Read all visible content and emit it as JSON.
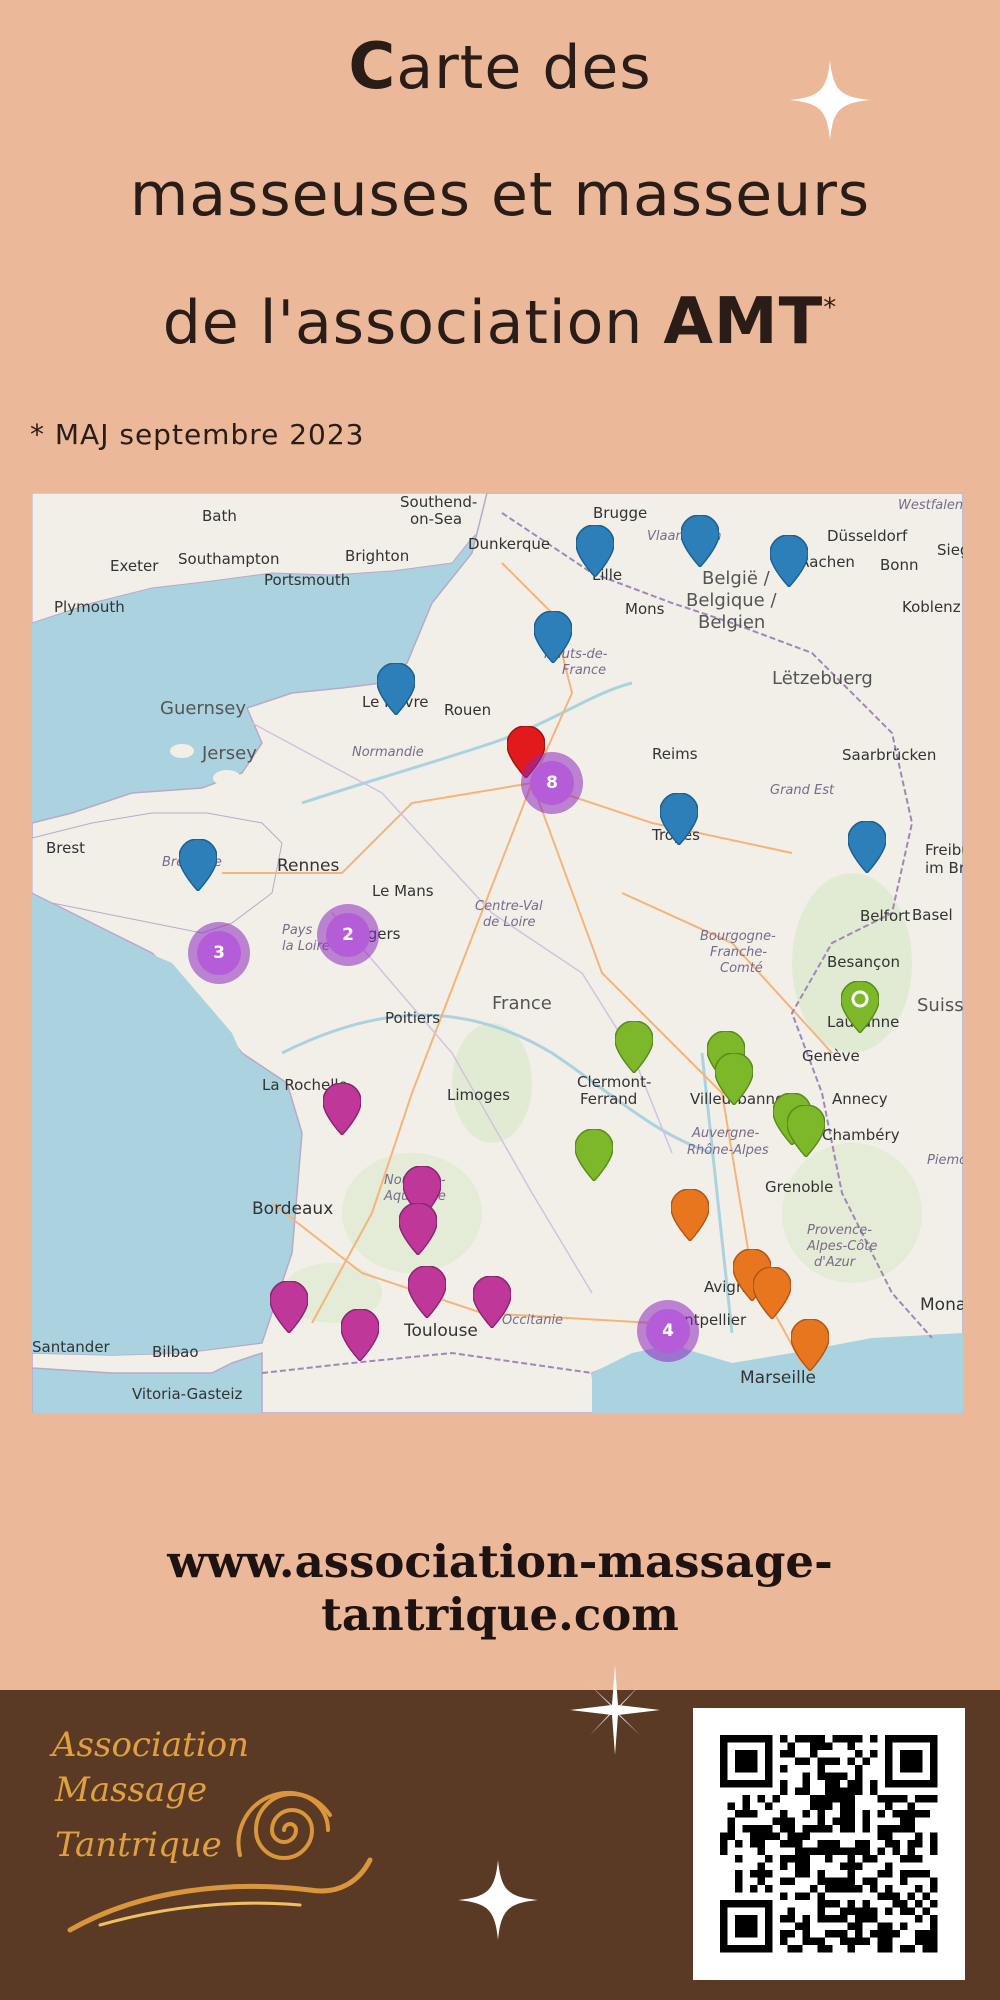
{
  "header": {
    "title_line1_first": "C",
    "title_line1_rest": "arte des",
    "title_line2": "masseuses et masseurs",
    "title_line3_prefix": "de l'association ",
    "title_line3_bold": "AMT",
    "title_line3_star": "*",
    "update_note": "* MAJ septembre 2023"
  },
  "map": {
    "labels": {
      "bath": "Bath",
      "southend": "Southend-",
      "onsea": "on-Sea",
      "brugge": "Brugge",
      "westfalen": "Westfalen",
      "exeter": "Exeter",
      "southampton": "Southampton",
      "brighton": "Brighton",
      "dunkerque": "Dunkerque",
      "vlaanderen": "Vlaanderen",
      "dusseldorf": "Düsseldorf",
      "portsmouth": "Portsmouth",
      "aachen": "Aachen",
      "bonn": "Bonn",
      "sieg": "Sieg",
      "plymouth": "Plymouth",
      "lille": "Lille",
      "mons": "Mons",
      "belgie1": "België /",
      "belgie2": "Belgique /",
      "belgie3": "Belgien",
      "koblenz": "Koblenz",
      "hauts1": "Hauts-de-",
      "hauts2": "France",
      "letzebuerg": "Lëtzebuerg",
      "guernsey": "Guernsey",
      "lehavre": "Le Havre",
      "rouen": "Rouen",
      "jersey": "Jersey",
      "normandie": "Normandie",
      "reims": "Reims",
      "saarbrucken": "Saarbrücken",
      "grandest": "Grand Est",
      "brest": "Brest",
      "rennes": "Rennes",
      "troyes": "Troyes",
      "freiburg1": "Freibu",
      "freiburg2": "im Breis",
      "lemans": "Le Mans",
      "bretagne": "Bretagne",
      "centre1": "Centre-Val",
      "centre2": "de Loire",
      "belfort": "Belfort",
      "basel": "Basel",
      "pays1": "Pays",
      "pays2": "la Loire",
      "angers": "Angers",
      "bourgogne1": "Bourgogne-",
      "bourgogne2": "Franche-",
      "bourgogne3": "Comté",
      "besancon": "Besançon",
      "france": "France",
      "poitiers": "Poitiers",
      "lausanne": "Lausanne",
      "suisse": "Suiss",
      "geneve": "Genève",
      "larochelle": "La Rochelle",
      "limoges": "Limoges",
      "clermont1": "Clermont-",
      "clermont2": "Ferrand",
      "villeurbanne": "Villeurbanne",
      "annecy": "Annecy",
      "auvergne1": "Auvergne-",
      "auvergne2": "Rhône-Alpes",
      "chambery": "Chambéry",
      "piemonte": "Piemo",
      "grenoble": "Grenoble",
      "bordeaux": "Bordeaux",
      "nouvelle1": "Nouvelle-",
      "nouvelle2": "Aquitaine",
      "provence1": "Provence-",
      "provence2": "Alpes-Côte",
      "provence3": "d'Azur",
      "avignon": "Avignon",
      "monaco": "Monaco",
      "santander": "Santander",
      "bilbao": "Bilbao",
      "toulouse": "Toulouse",
      "occitanie": "Occitanie",
      "montpellier": "Montpellier",
      "marseille": "Marseille",
      "vitoria": "Vitoria-Gasteiz"
    },
    "clusters": [
      {
        "id": "paris",
        "count": "8"
      },
      {
        "id": "angers",
        "count": "2"
      },
      {
        "id": "nantes",
        "count": "3"
      },
      {
        "id": "montpellier",
        "count": "4"
      }
    ],
    "pin_colors": {
      "blue": "#2c7fb8",
      "red": "#e31a1c",
      "green": "#7db82a",
      "magenta": "#c0379a",
      "orange": "#e8761f"
    }
  },
  "website": "www.association-massage-tantrique.com",
  "footer": {
    "logo_line1": "Association",
    "logo_line2": "Massage",
    "logo_line3": "Tantrique"
  }
}
